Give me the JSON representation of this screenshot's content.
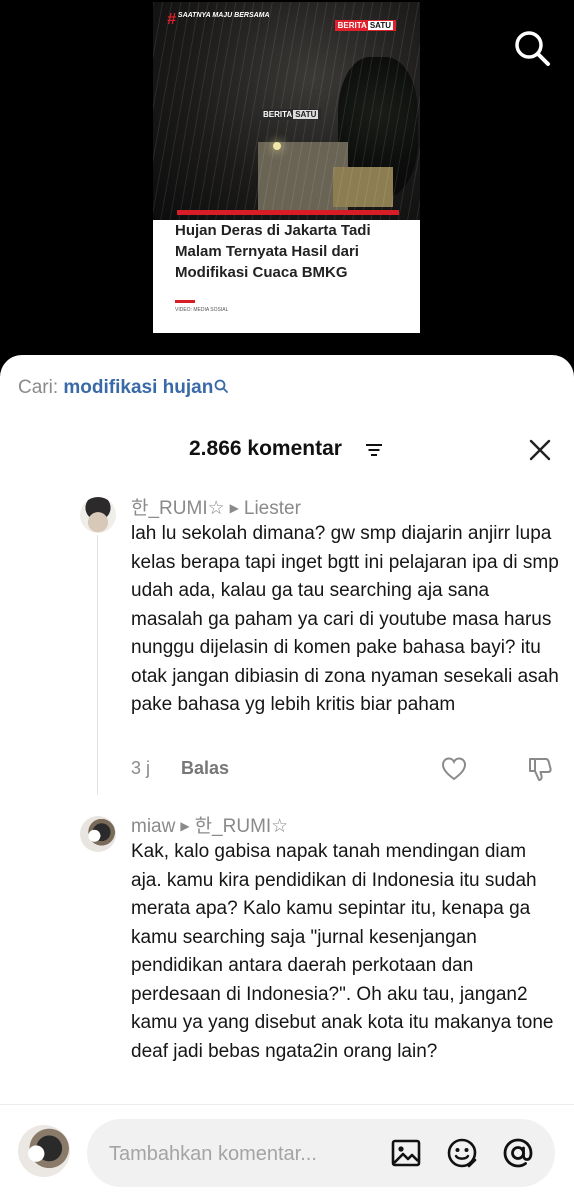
{
  "video": {
    "tagline": "SAATNYA MAJU BERSAMA",
    "brand_left": "BERITA",
    "brand_right": "SATU",
    "headline": "Hujan Deras di Jakarta Tadi Malam Ternyata Hasil dari Modifikasi Cuaca BMKG",
    "source": "VIDEO: MEDIA SOSIAL"
  },
  "search": {
    "prefix": "Cari:",
    "term": "modifikasi hujan"
  },
  "comments_header": {
    "count_label": "2.866 komentar"
  },
  "comments": [
    {
      "author": "한_RUMI☆",
      "reply_to": "Liester",
      "text": "lah lu sekolah dimana? gw smp diajarin anjirr lupa kelas berapa tapi inget bgtt ini pelajaran ipa di smp udah ada, kalau ga tau searching aja sana masalah ga paham ya cari di youtube masa harus nunggu dijelasin di komen pake bahasa bayi? itu otak jangan dibiasin di zona nyaman sesekali asah pake bahasa yg lebih kritis biar paham",
      "time": "3 j",
      "reply_label": "Balas"
    },
    {
      "author": "miaw",
      "reply_to": "한_RUMI☆",
      "text": "Kak, kalo gabisa napak tanah mendingan diam aja. kamu kira pendidikan di Indonesia itu sudah merata apa? Kalo kamu sepintar itu, kenapa ga kamu searching saja \"jurnal kesenjangan pendidikan antara daerah perkotaan dan perdesaan di Indonesia?\". Oh aku tau, jangan2 kamu ya yang disebut anak kota itu makanya tone deaf jadi bebas ngata2in orang lain?"
    }
  ],
  "composer": {
    "placeholder": "Tambahkan komentar..."
  }
}
